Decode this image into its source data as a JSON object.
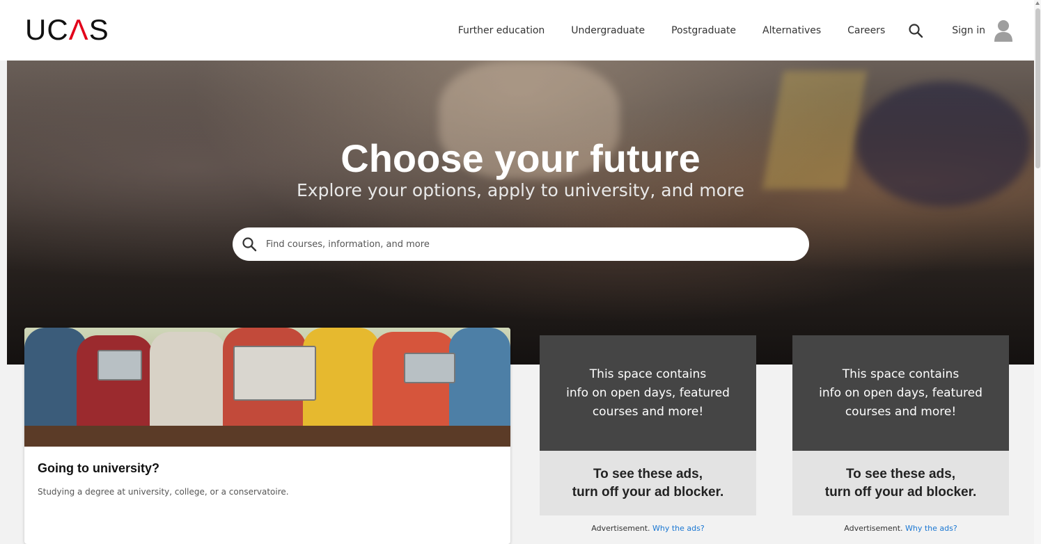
{
  "brand": {
    "logo_text_left": "UC",
    "logo_caret": "Λ",
    "logo_text_right": "S"
  },
  "nav": {
    "items": [
      "Further education",
      "Undergraduate",
      "Postgraduate",
      "Alternatives",
      "Careers"
    ],
    "search_icon": "search-icon",
    "sign_in": "Sign in",
    "avatar_icon": "user-avatar-icon"
  },
  "hero": {
    "title": "Choose your future",
    "subtitle": "Explore your options, apply to university, and more",
    "search": {
      "placeholder": "Find courses, information, and more",
      "value": ""
    }
  },
  "card": {
    "title": "Going to university?",
    "description": "Studying a degree at university, college, or a conservatoire."
  },
  "ads": [
    {
      "top_text": "This space contains\ninfo on open days, featured\ncourses and more!",
      "bottom_text": "To see these ads,\nturn off your ad blocker.",
      "caption": "Advertisement.",
      "link": "Why the ads?"
    },
    {
      "top_text": "This space contains\ninfo on open days, featured\ncourses and more!",
      "bottom_text": "To see these ads,\nturn off your ad blocker.",
      "caption": "Advertisement.",
      "link": "Why the ads?"
    }
  ],
  "colors": {
    "brand_red": "#e2001a",
    "link_blue": "#1976d2",
    "ad_dark": "#454545",
    "ad_light": "#e3e3e3"
  }
}
